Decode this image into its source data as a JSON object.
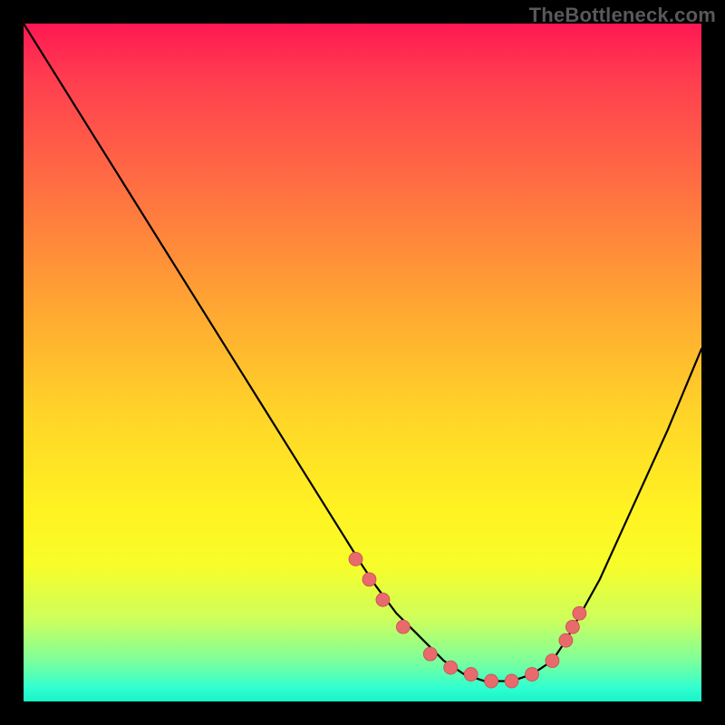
{
  "watermark": "TheBottleneck.com",
  "chart_data": {
    "type": "line",
    "title": "",
    "xlabel": "",
    "ylabel": "",
    "xlim": [
      0,
      100
    ],
    "ylim": [
      0,
      100
    ],
    "curve": {
      "x": [
        0,
        5,
        10,
        15,
        20,
        25,
        30,
        35,
        40,
        45,
        50,
        52,
        55,
        58,
        60,
        62,
        65,
        68,
        70,
        72,
        75,
        78,
        80,
        85,
        90,
        95,
        100
      ],
      "y": [
        100,
        92,
        84,
        76,
        68,
        60,
        52,
        44,
        36,
        28,
        20,
        17,
        13,
        10,
        8,
        6,
        4,
        3,
        3,
        3,
        4,
        6,
        9,
        18,
        29,
        40,
        52
      ]
    },
    "marked_points": {
      "x": [
        49,
        51,
        53,
        56,
        60,
        63,
        66,
        69,
        72,
        75,
        78,
        80,
        81,
        82
      ],
      "y": [
        21,
        18,
        15,
        11,
        7,
        5,
        4,
        3,
        3,
        4,
        6,
        9,
        11,
        13
      ]
    }
  }
}
